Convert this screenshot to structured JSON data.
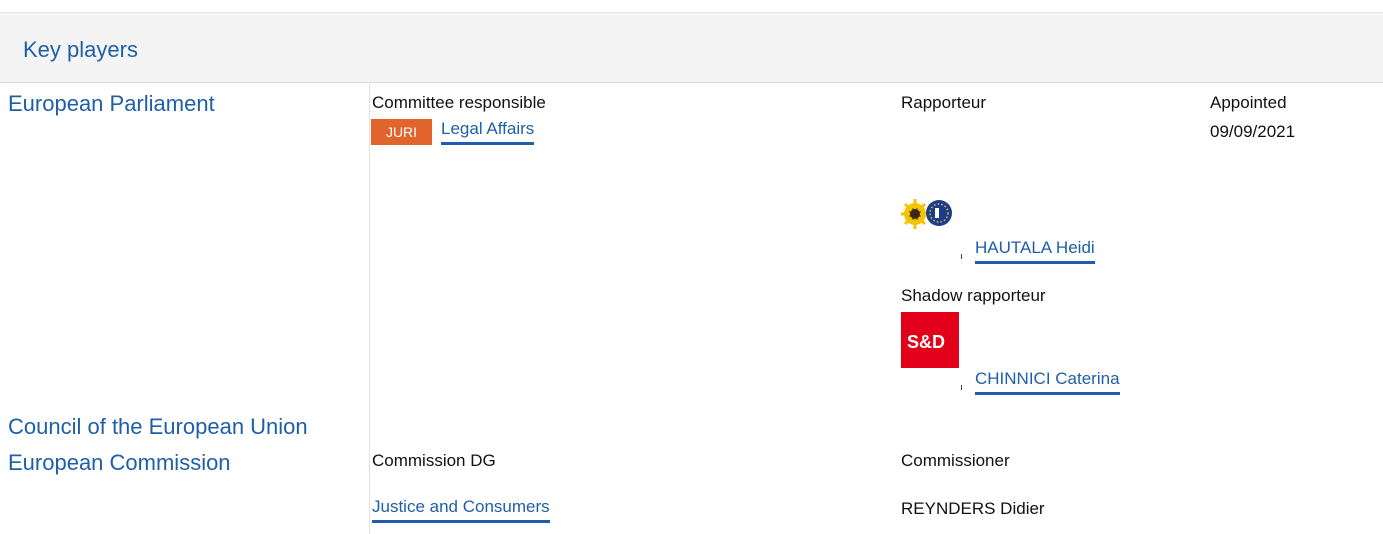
{
  "panel": {
    "title": "Key players"
  },
  "institutions": {
    "parliament": "European Parliament",
    "council": "Council of the European Union",
    "commission": "European Commission"
  },
  "parliament": {
    "committee_label": "Committee responsible",
    "rapporteur_label": "Rapporteur",
    "appointed_label": "Appointed",
    "committee_badge": "JURI",
    "badge_color": "#e0642c",
    "committee_name": "Legal Affairs",
    "appointed_date": "09/09/2021",
    "rapporteur_name": "HAUTALA Heidi",
    "rapporteur_group_icon": "greens-efa-logo",
    "shadow_label": "Shadow rapporteur",
    "shadow_group_icon": "sd-logo",
    "shadow_group_logo_text": "S&D",
    "shadow_name": "CHINNICI Caterina"
  },
  "commission": {
    "dg_label": "Commission DG",
    "commissioner_label": "Commissioner",
    "dg_name": "Justice and Consumers",
    "commissioner_name": "REYNDERS Didier"
  },
  "colors": {
    "link": "#1f5fa8",
    "header_bg": "#f4f4f4",
    "sd_red": "#e2001a"
  }
}
